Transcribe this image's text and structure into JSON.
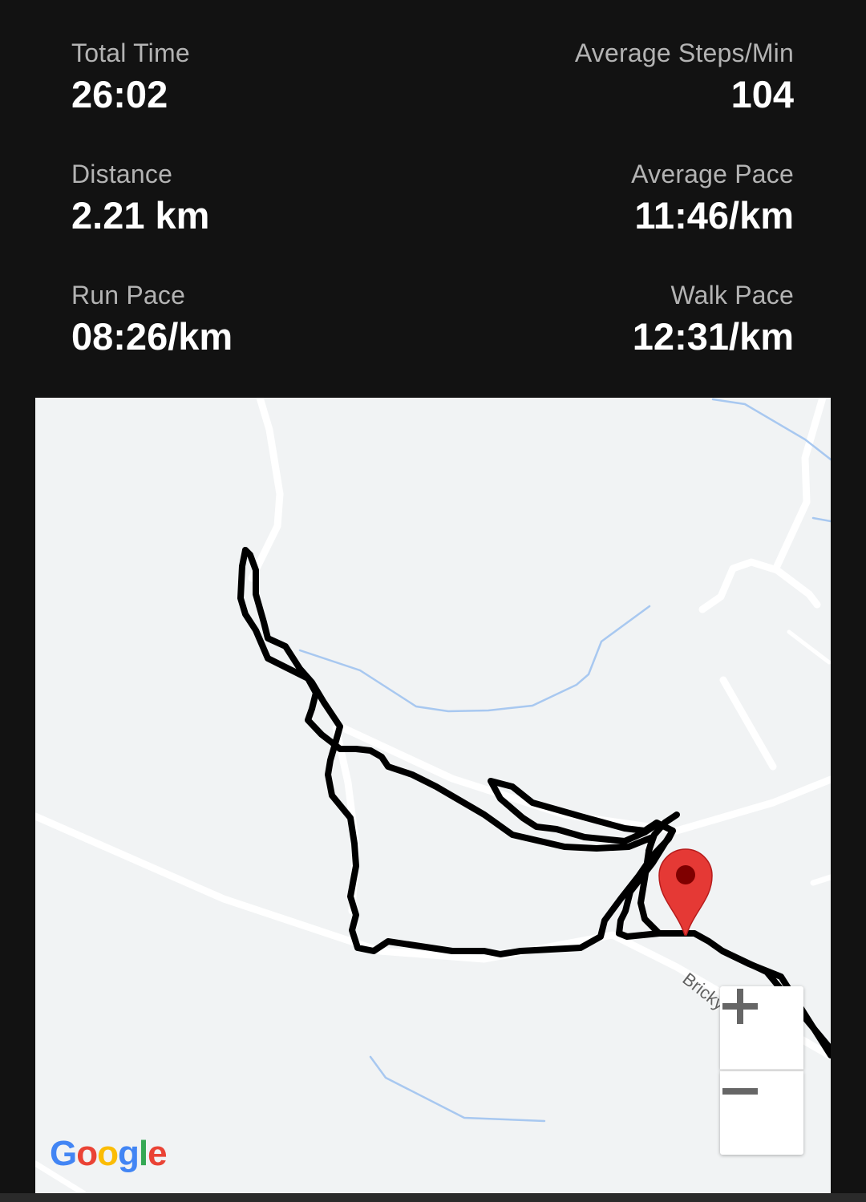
{
  "stats": {
    "total_time": {
      "label": "Total Time",
      "value": "26:02"
    },
    "avg_steps": {
      "label": "Average Steps/Min",
      "value": "104"
    },
    "distance": {
      "label": "Distance",
      "value": "2.21 km"
    },
    "avg_pace": {
      "label": "Average Pace",
      "value": "11:46/km"
    },
    "run_pace": {
      "label": "Run Pace",
      "value": "08:26/km"
    },
    "walk_pace": {
      "label": "Walk Pace",
      "value": "12:31/km"
    }
  },
  "map": {
    "street_name": "Brickyard Ln",
    "logo": "Google",
    "zoom_in_icon": "plus-icon",
    "zoom_out_icon": "minus-icon",
    "marker_icon": "location-pin-icon",
    "colors": {
      "background": "#f1f3f4",
      "road": "#ffffff",
      "water": "#a8c8f0",
      "route": "#000000",
      "marker": "#e53935"
    }
  }
}
